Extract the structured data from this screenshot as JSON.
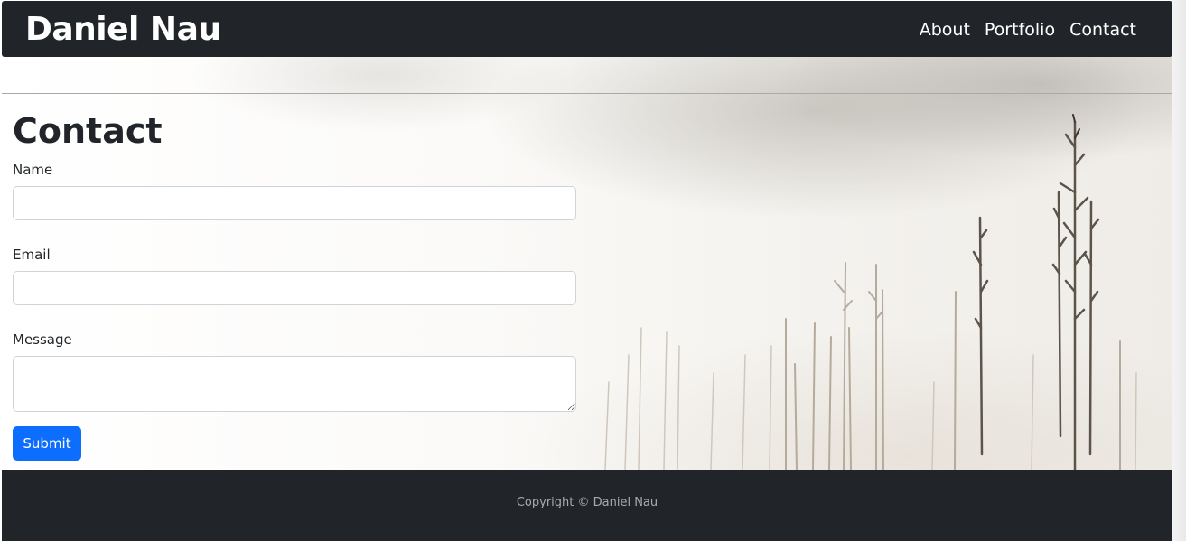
{
  "navbar": {
    "brand": "Daniel Nau",
    "links": [
      "About",
      "Portfolio",
      "Contact"
    ]
  },
  "contact": {
    "title": "Contact",
    "name_label": "Name",
    "name_value": "",
    "email_label": "Email",
    "email_value": "",
    "message_label": "Message",
    "message_value": "",
    "submit_label": "Submit"
  },
  "footer": {
    "copyright": "Copyright © Daniel Nau"
  },
  "colors": {
    "navbar_bg": "#212529",
    "footer_bg": "#212529",
    "primary": "#0d6efd"
  }
}
